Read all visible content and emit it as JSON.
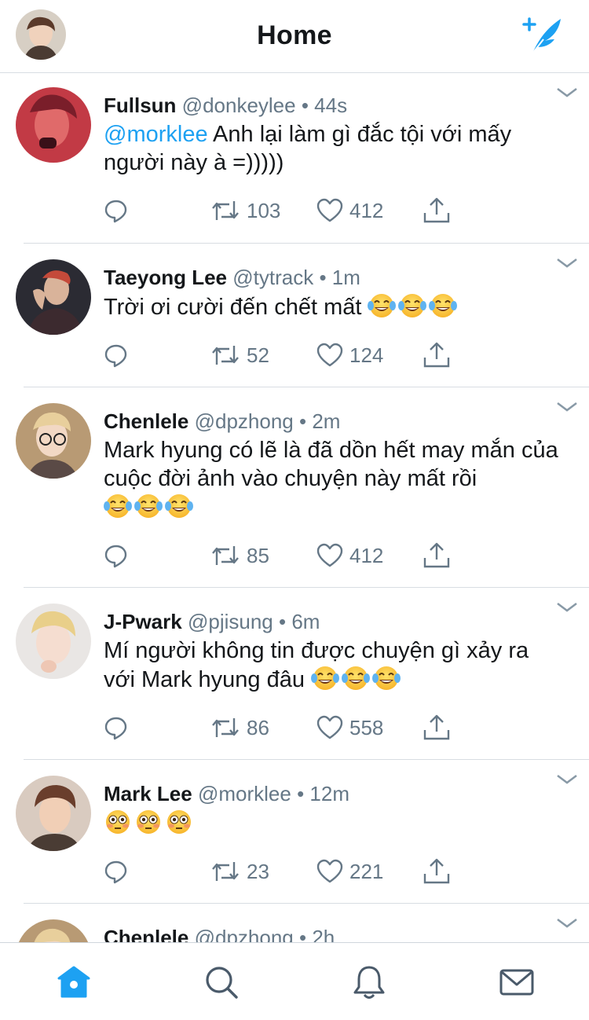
{
  "header": {
    "title": "Home",
    "avatar_icon": "profile-avatar",
    "compose_icon": "compose-feather-icon"
  },
  "colors": {
    "accent": "#1da1f2",
    "meta": "#657786",
    "text": "#14171a",
    "tab_active": "#1da1f2",
    "tab_inactive": "#4a5a6a"
  },
  "tweets": [
    {
      "name": "Fullsun",
      "handle": "@donkeylee",
      "time": "• 44s",
      "mention": "@morklee",
      "text": " Anh lại làm gì đắc tội với mấy người này à =)))))",
      "replies": "",
      "retweets": "103",
      "likes": "412"
    },
    {
      "name": "Taeyong Lee",
      "handle": "@tytrack",
      "time": "• 1m",
      "text": "Trời ơi cười đến chết mất ",
      "emojis": [
        "face-with-tears-of-joy",
        "face-with-tears-of-joy",
        "face-with-tears-of-joy"
      ],
      "retweets": "52",
      "likes": "124"
    },
    {
      "name": "Chenlele",
      "handle": "@dpzhong",
      "time": "• 2m",
      "text": "Mark hyung có lẽ là đã dồn hết may mắn của cuộc đời ảnh vào chuyện này mất rồi",
      "emojis": [
        "face-with-tears-of-joy",
        "face-with-tears-of-joy",
        "face-with-tears-of-joy"
      ],
      "retweets": "85",
      "likes": "412"
    },
    {
      "name": "J-Pwark",
      "handle": "@pjisung",
      "time": "• 6m",
      "text": "Mí người không tin được chuyện gì xảy ra với Mark hyung đâu ",
      "emojis": [
        "face-with-tears-of-joy",
        "face-with-tears-of-joy",
        "face-with-tears-of-joy"
      ],
      "retweets": "86",
      "likes": "558"
    },
    {
      "name": "Mark Lee",
      "handle": "@morklee",
      "time": "• 12m",
      "text": "",
      "emojis": [
        "flushed-face",
        "flushed-face",
        "flushed-face"
      ],
      "retweets": "23",
      "likes": "221"
    },
    {
      "name": "Chenlele",
      "handle": "@dpzhong",
      "time": "• 2h"
    }
  ],
  "tabs": [
    {
      "name": "home",
      "icon": "home-icon",
      "active": true
    },
    {
      "name": "search",
      "icon": "search-icon",
      "active": false
    },
    {
      "name": "notifications",
      "icon": "bell-icon",
      "active": false
    },
    {
      "name": "messages",
      "icon": "envelope-icon",
      "active": false
    }
  ]
}
